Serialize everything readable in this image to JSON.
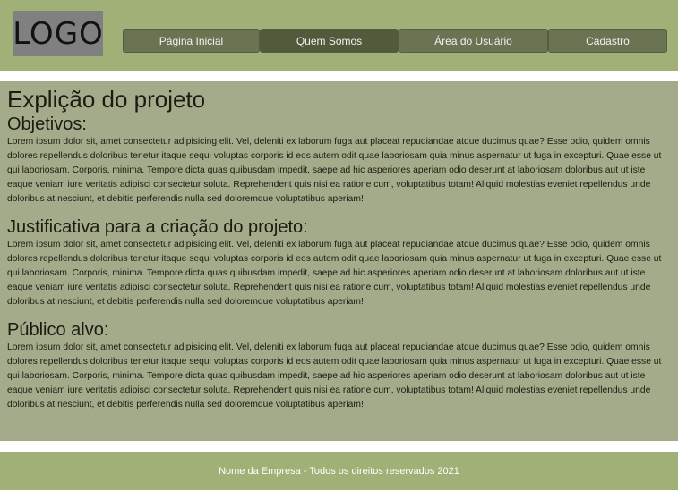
{
  "header": {
    "logo_text": "LOGO",
    "nav": [
      {
        "label": "Página Inicial"
      },
      {
        "label": "Quem Somos"
      },
      {
        "label": "Área do Usuário"
      },
      {
        "label": "Cadastro"
      }
    ],
    "active_nav": "Quem Somos"
  },
  "main": {
    "title": "Explição do projeto",
    "sections": [
      {
        "title": "Objetivos:",
        "text": "Lorem ipsum dolor sit, amet consectetur adipisicing elit. Vel, deleniti ex laborum fuga aut placeat repudiandae atque ducimus quae? Esse odio, quidem omnis dolores repellendus doloribus tenetur itaque sequi voluptas corporis id eos autem odit quae laboriosam quia minus aspernatur ut fuga in excepturi. Quae esse ut qui laboriosam. Corporis, minima. Tempore dicta quas quibusdam impedit, saepe ad hic asperiores aperiam odio deserunt at laboriosam doloribus aut ut iste eaque veniam iure veritatis adipisci consectetur soluta. Reprehenderit quis nisi ea ratione cum, voluptatibus totam! Aliquid molestias eveniet repellendus unde doloribus at nesciunt, et debitis perferendis nulla sed doloremque voluptatibus aperiam!"
      },
      {
        "title": "Justificativa para a criação do projeto:",
        "text": "Lorem ipsum dolor sit, amet consectetur adipisicing elit. Vel, deleniti ex laborum fuga aut placeat repudiandae atque ducimus quae? Esse odio, quidem omnis dolores repellendus doloribus tenetur itaque sequi voluptas corporis id eos autem odit quae laboriosam quia minus aspernatur ut fuga in excepturi. Quae esse ut qui laboriosam. Corporis, minima. Tempore dicta quas quibusdam impedit, saepe ad hic asperiores aperiam odio deserunt at laboriosam doloribus aut ut iste eaque veniam iure veritatis adipisci consectetur soluta. Reprehenderit quis nisi ea ratione cum, voluptatibus totam! Aliquid molestias eveniet repellendus unde doloribus at nesciunt, et debitis perferendis nulla sed doloremque voluptatibus aperiam!"
      },
      {
        "title": "Público alvo:",
        "text": "Lorem ipsum dolor sit, amet consectetur adipisicing elit. Vel, deleniti ex laborum fuga aut placeat repudiandae atque ducimus quae? Esse odio, quidem omnis dolores repellendus doloribus tenetur itaque sequi voluptas corporis id eos autem odit quae laboriosam quia minus aspernatur ut fuga in excepturi. Quae esse ut qui laboriosam. Corporis, minima. Tempore dicta quas quibusdam impedit, saepe ad hic asperiores aperiam odio deserunt at laboriosam doloribus aut ut iste eaque veniam iure veritatis adipisci consectetur soluta. Reprehenderit quis nisi ea ratione cum, voluptatibus totam! Aliquid molestias eveniet repellendus unde doloribus at nesciunt, et debitis perferendis nulla sed doloremque voluptatibus aperiam!"
      }
    ]
  },
  "footer": {
    "text": "Nome da Empresa - Todos os direitos reservados 2021"
  },
  "colors": {
    "header_bg": "#a1b076",
    "main_bg": "#a4ab8a",
    "nav_bg": "#6b7452",
    "nav_active": "#525a3b"
  }
}
